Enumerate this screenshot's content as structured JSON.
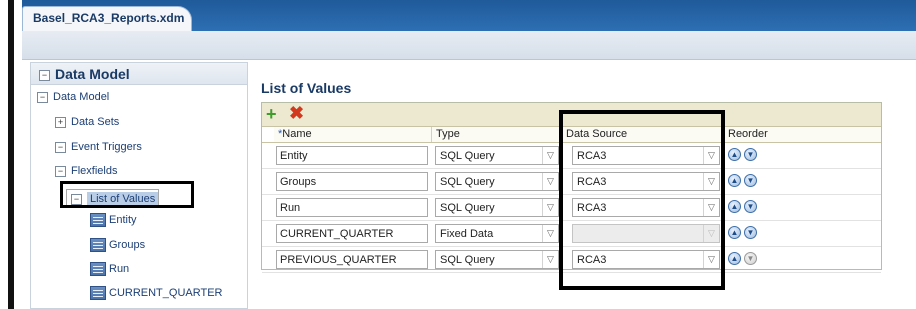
{
  "window": {
    "tab_title": "Basel_RCA3_Reports.xdm"
  },
  "left_panel": {
    "header": "Data Model",
    "tree": {
      "root": "Data Model",
      "items": [
        {
          "label": "Data Sets",
          "toggle": "+"
        },
        {
          "label": "Event Triggers",
          "toggle": "−"
        },
        {
          "label": "Flexfields",
          "toggle": "−"
        },
        {
          "label": "List of Values",
          "toggle": "−",
          "selected": true
        }
      ],
      "lov_children": [
        "Entity",
        "Groups",
        "Run",
        "CURRENT_QUARTER"
      ]
    }
  },
  "main": {
    "title": "List of Values",
    "toolbar": {
      "add_icon": "+",
      "delete_icon": "✖"
    },
    "columns": {
      "required_mark": "*",
      "name": "Name",
      "type": "Type",
      "data_source": "Data Source",
      "reorder": "Reorder"
    },
    "rows": [
      {
        "name": "Entity",
        "type": "SQL Query",
        "data_source": "RCA3",
        "ds_enabled": true
      },
      {
        "name": "Groups",
        "type": "SQL Query",
        "data_source": "RCA3",
        "ds_enabled": true
      },
      {
        "name": "Run",
        "type": "SQL Query",
        "data_source": "RCA3",
        "ds_enabled": true
      },
      {
        "name": "CURRENT_QUARTER",
        "type": "Fixed Data",
        "data_source": "",
        "ds_enabled": false
      },
      {
        "name": "PREVIOUS_QUARTER",
        "type": "SQL Query",
        "data_source": "RCA3",
        "ds_enabled": true
      }
    ],
    "reorder_glyphs": {
      "up": "▲",
      "down": "▼"
    },
    "dropdown_glyph": "▽"
  },
  "colors": {
    "tabstrip": "#2d6fb3",
    "selection": "#b9cde6",
    "grid_toolbar": "#ece9d0",
    "highlight_box": "#000000"
  }
}
